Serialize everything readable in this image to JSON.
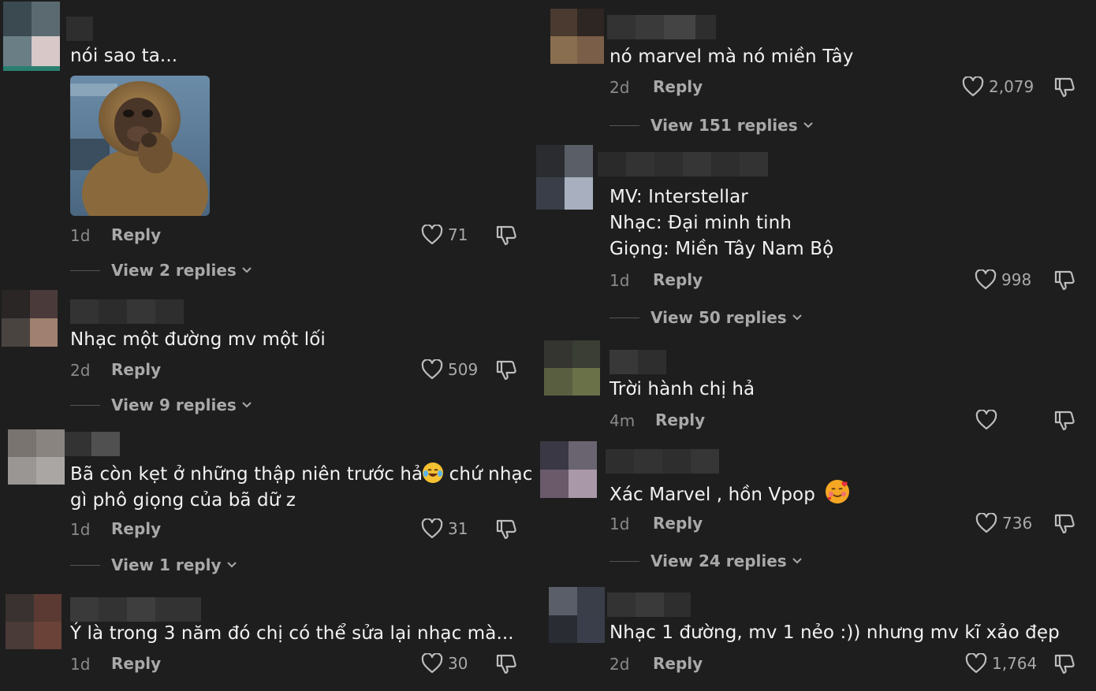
{
  "labels": {
    "reply": "Reply"
  },
  "left_comments": [
    {
      "text": [
        "nói sao ta..."
      ],
      "age": "1d",
      "likes": "71",
      "view": "View 2 replies"
    },
    {
      "text": [
        "Nhạc một đường mv một lối"
      ],
      "age": "2d",
      "likes": "509",
      "view": "View 9 replies"
    },
    {
      "text": [
        "Bã còn kẹt ở những thập niên trước hả",
        "gì phô giọng của bã dữ z"
      ],
      "text_after_emoji": " chứ nhạc",
      "emoji": "face-with-tears-of-joy",
      "age": "1d",
      "likes": "31",
      "view": "View 1 reply"
    },
    {
      "text": [
        "Ý là trong 3 năm đó chị có thể sửa lại nhạc mà..."
      ],
      "age": "1d",
      "likes": "30"
    }
  ],
  "right_comments": [
    {
      "text": [
        "nó marvel mà nó miền Tây"
      ],
      "age": "2d",
      "likes": "2,079",
      "view": "View 151 replies"
    },
    {
      "text": [
        "MV: Interstellar",
        "Nhạc: Đại minh tinh",
        "Giọng: Miền Tây Nam Bộ"
      ],
      "age": "1d",
      "likes": "998",
      "view": "View 50 replies"
    },
    {
      "text": [
        "Trời hành chị hả"
      ],
      "age": "4m",
      "likes": ""
    },
    {
      "text": [
        "Xác Marvel , hồn Vpop"
      ],
      "emoji": "smiling-face-with-hearts",
      "age": "1d",
      "likes": "736",
      "view": "View 24 replies"
    },
    {
      "text": [
        "Nhạc 1 đường, mv 1 nẻo :)) nhưng mv kĩ xảo đẹp"
      ],
      "age": "2d",
      "likes": "1,764"
    }
  ],
  "icons": {
    "like": "heart-outline-icon",
    "dislike": "thumbs-down-icon",
    "chevron": "chevron-down-icon",
    "attachment": "monkey-thinking-image"
  },
  "colors": {
    "background": "#1e1e1e",
    "text": "#f2f2f2",
    "muted": "#8a8a8a"
  }
}
